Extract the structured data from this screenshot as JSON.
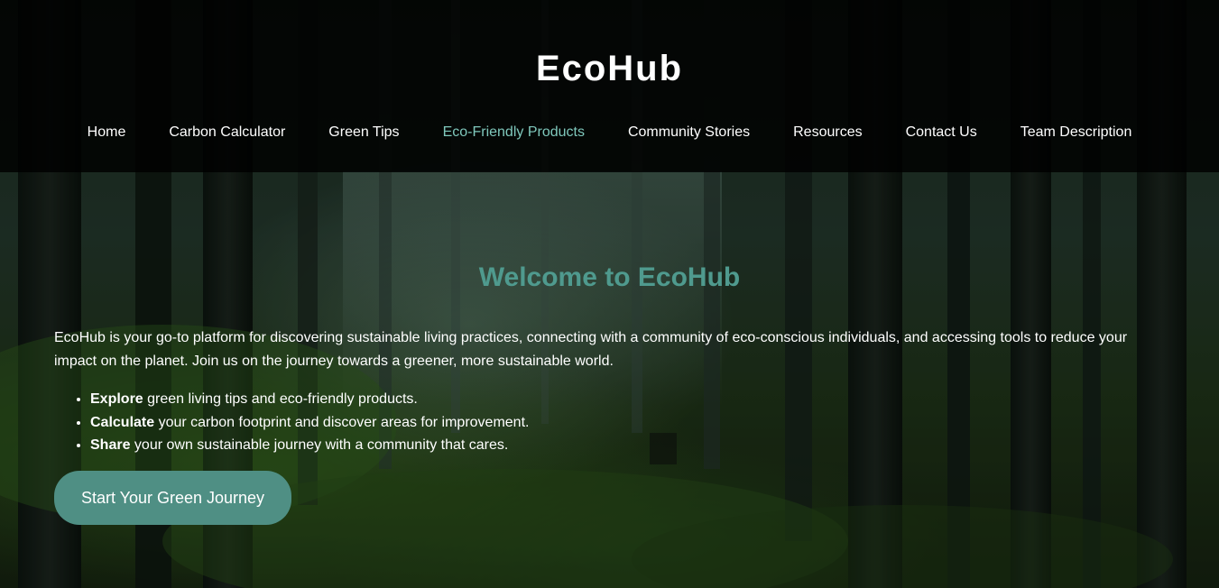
{
  "site": {
    "logo": "EcoHub"
  },
  "nav": {
    "items": [
      {
        "label": "Home"
      },
      {
        "label": "Carbon Calculator"
      },
      {
        "label": "Green Tips"
      },
      {
        "label": "Eco-Friendly Products"
      },
      {
        "label": "Community Stories"
      },
      {
        "label": "Resources"
      },
      {
        "label": "Contact Us"
      },
      {
        "label": "Team Description"
      }
    ],
    "active_color": "#7fc8bc"
  },
  "hero": {
    "title": "Welcome to EcoHub",
    "intro": "EcoHub is your go-to platform for discovering sustainable living practices, connecting with a community of eco-conscious individuals, and accessing tools to reduce your impact on the planet. Join us on the journey towards a greener, more sustainable world.",
    "features": [
      {
        "strong": "Explore",
        "text": " green living tips and eco-friendly products."
      },
      {
        "strong": "Calculate",
        "text": " your carbon footprint and discover areas for improvement."
      },
      {
        "strong": "Share",
        "text": " your own sustainable journey with a community that cares."
      }
    ],
    "cta_label": "Start Your Green Journey"
  },
  "colors": {
    "accent": "#4f9a8e",
    "button": "#4f8f84",
    "header_bg": "#000000"
  }
}
